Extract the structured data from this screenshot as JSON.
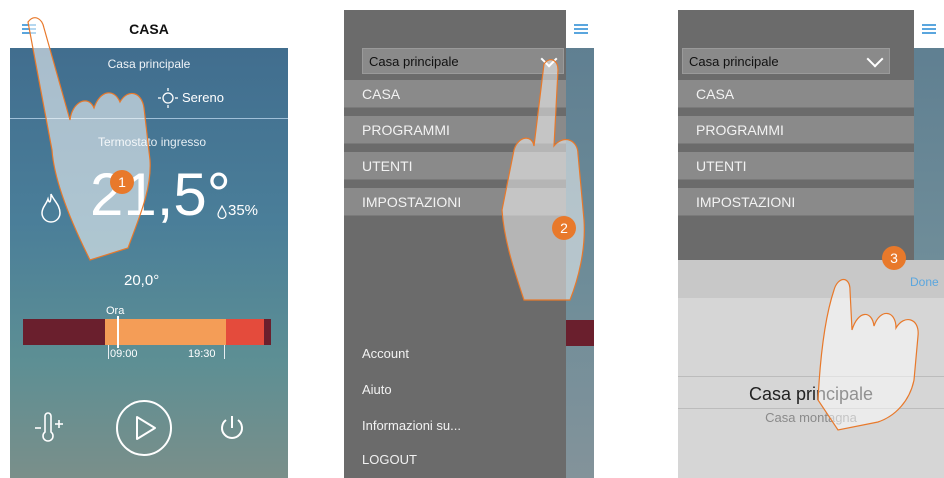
{
  "screen1": {
    "title": "CASA",
    "home_name": "Casa principale",
    "weather": "Sereno",
    "thermostat_name": "Termostato ingresso",
    "temperature": "21,5°",
    "humidity": "35%",
    "setpoint": "20,0°",
    "now_label": "Ora",
    "time_start": "09:00",
    "time_end": "19:30",
    "step": "1",
    "icons": [
      "menu-icon",
      "sun-icon",
      "flame-icon",
      "drop-icon",
      "thermometer-plus-icon",
      "play-icon",
      "power-icon"
    ]
  },
  "screen2": {
    "dropdown_value": "Casa principale",
    "menu_items": [
      "CASA",
      "PROGRAMMI",
      "UTENTI",
      "IMPOSTAZIONI"
    ],
    "bottom_items": [
      "Account",
      "Aiuto",
      "Informazioni su...",
      "LOGOUT"
    ],
    "step": "2"
  },
  "screen3": {
    "dropdown_value": "Casa principale",
    "menu_items": [
      "CASA",
      "PROGRAMMI",
      "UTENTI",
      "IMPOSTAZIONI"
    ],
    "done_label": "Done",
    "picker_selected": "Casa principale",
    "picker_next": "Casa montagna",
    "step": "3"
  },
  "colors": {
    "accent": "#5aa6de",
    "step_badge": "#e8792b",
    "menu_bg": "#6b6b6b",
    "menu_item_bg": "#8a8a8a"
  }
}
